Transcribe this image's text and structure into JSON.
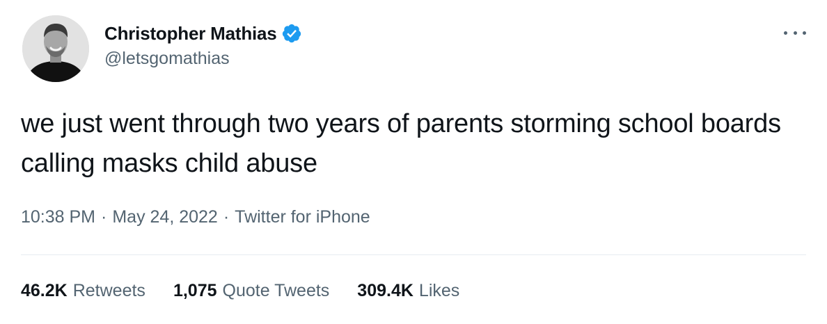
{
  "author": {
    "name": "Christopher Mathias",
    "handle": "@letsgomathias",
    "verified": true,
    "verified_color": "#1d9bf0"
  },
  "tweet": {
    "text": "we just went through two years of parents storming school boards calling masks child abuse",
    "time": "10:38 PM",
    "date": "May 24, 2022",
    "separator": "·",
    "source": "Twitter for iPhone"
  },
  "stats": [
    {
      "value": "46.2K",
      "label": "Retweets"
    },
    {
      "value": "1,075",
      "label": "Quote Tweets"
    },
    {
      "value": "309.4K",
      "label": "Likes"
    }
  ],
  "icons": {
    "more": "more-icon",
    "verified": "verified-badge-icon"
  },
  "colors": {
    "text_primary": "#0f1419",
    "text_secondary": "#536471",
    "divider": "#e6ecf0"
  }
}
